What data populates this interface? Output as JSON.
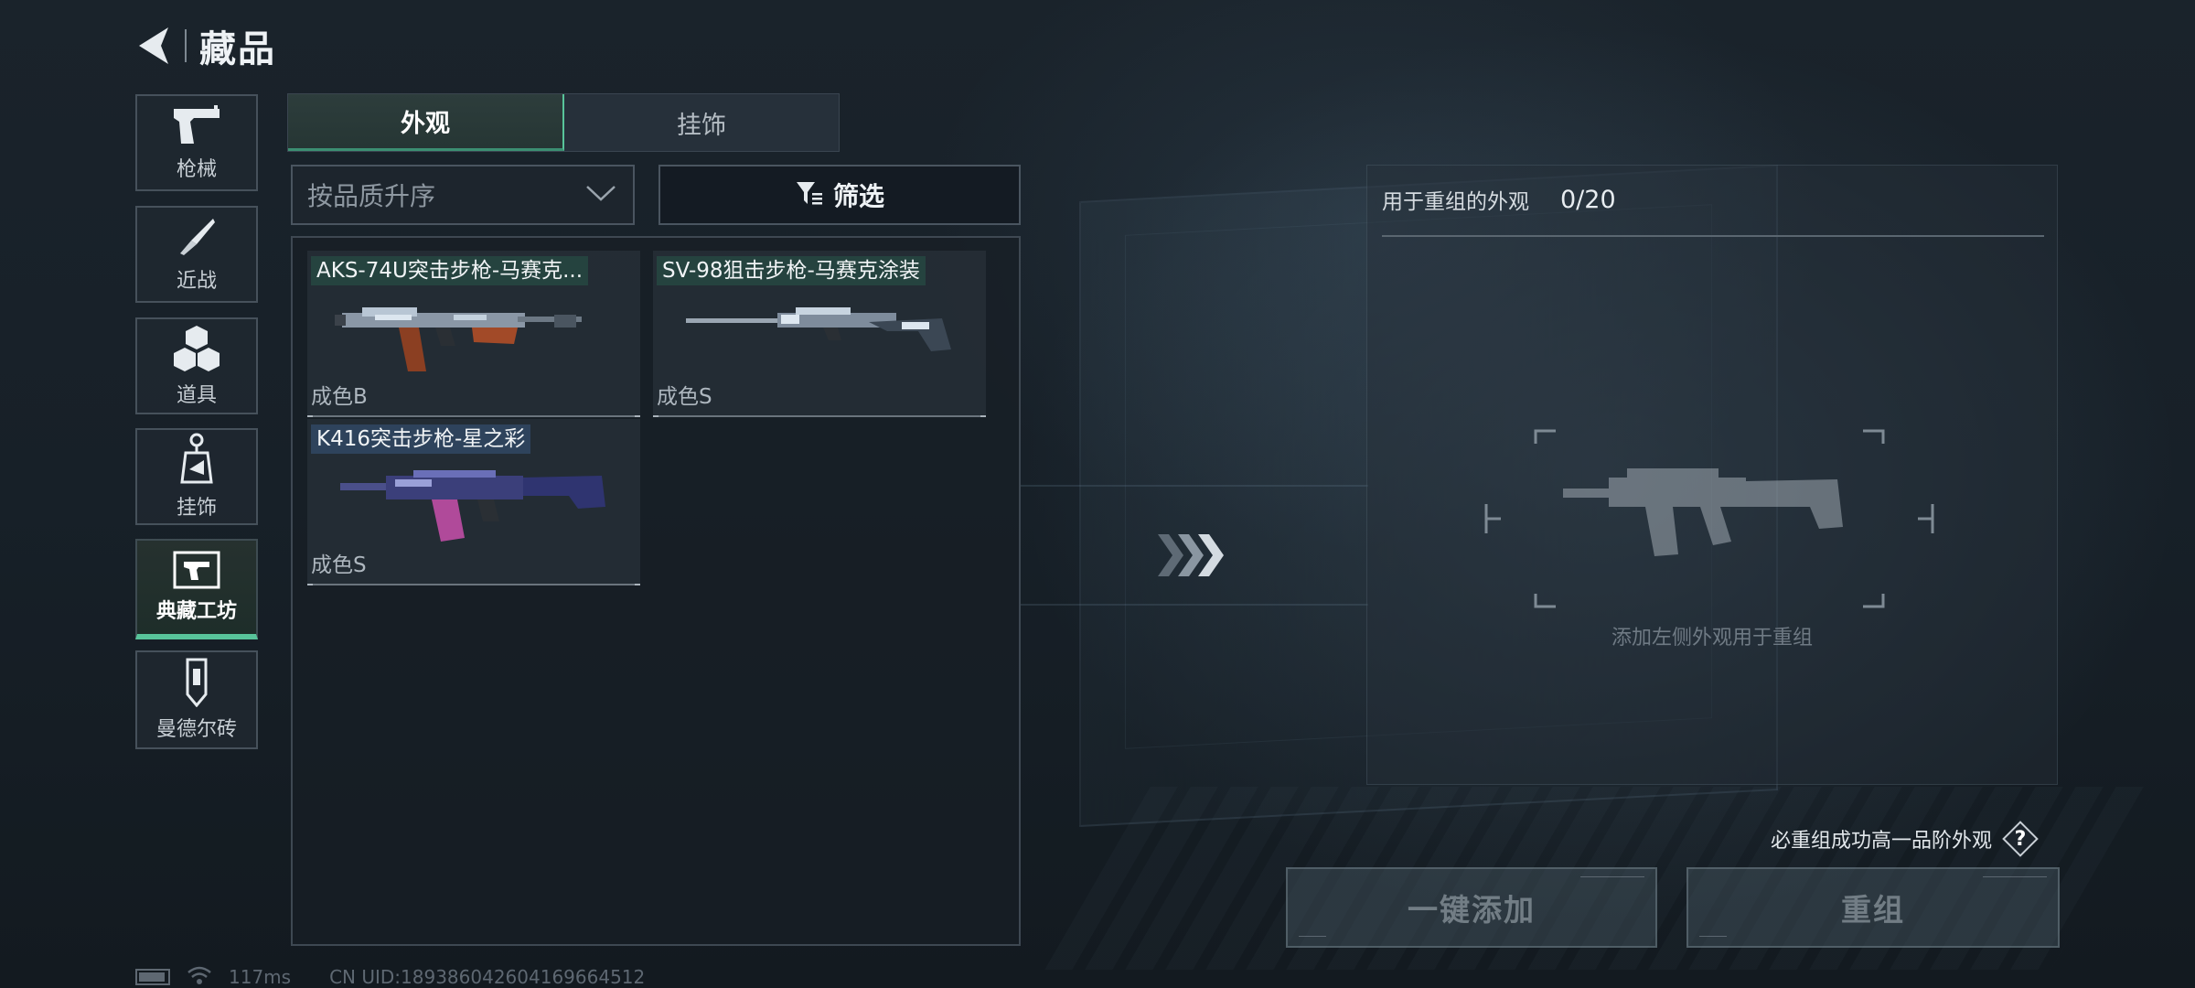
{
  "header": {
    "title": "藏品"
  },
  "sidebar": {
    "items": [
      {
        "label": "枪械",
        "icon": "pistol-icon",
        "active": false
      },
      {
        "label": "近战",
        "icon": "knife-icon",
        "active": false
      },
      {
        "label": "道具",
        "icon": "cubes-icon",
        "active": false
      },
      {
        "label": "挂饰",
        "icon": "charm-icon",
        "active": false
      },
      {
        "label": "典藏工坊",
        "icon": "workshop-icon",
        "active": true
      },
      {
        "label": "曼德尔砖",
        "icon": "brick-icon",
        "active": false
      }
    ]
  },
  "tabs": [
    {
      "label": "外观",
      "active": true
    },
    {
      "label": "挂饰",
      "active": false
    }
  ],
  "sort": {
    "value": "按品质升序"
  },
  "filter": {
    "label": "筛选"
  },
  "items": [
    {
      "name": "AKS-74U突击步枪-马赛克...",
      "grade": "成色B",
      "icon": "rifle-aks74u-icon"
    },
    {
      "name": "SV-98狙击步枪-马赛克涂装",
      "grade": "成色S",
      "icon": "rifle-sv98-icon"
    },
    {
      "name": "K416突击步枪-星之彩",
      "grade": "成色S",
      "icon": "rifle-k416-icon"
    }
  ],
  "recombine": {
    "label": "用于重组的外观",
    "count": "0/20",
    "hint": "添加左侧外观用于重组",
    "guarantee": "必重组成功高一品阶外观",
    "help": "?"
  },
  "actions": {
    "add_all": "一键添加",
    "recombine": "重组"
  },
  "status": {
    "ping": "117ms",
    "uid": "CN UID:189386042604169664512"
  },
  "colors": {
    "accent": "#58c49a",
    "background": "#141b22",
    "panel": "#26303a"
  }
}
